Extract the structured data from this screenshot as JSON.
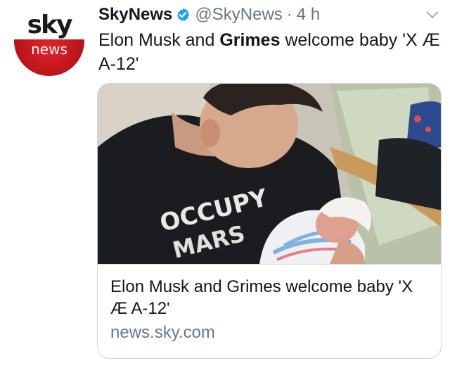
{
  "avatar": {
    "brand_top": "sky",
    "brand_bottom": "news"
  },
  "header": {
    "name": "SkyNews",
    "handle": "@SkyNews",
    "separator": "·",
    "time": "4 h"
  },
  "tweet": {
    "text_part1": "Elon Musk and ",
    "text_bold": "Grimes",
    "text_part2": " welcome baby 'X Æ A-12'"
  },
  "card": {
    "image_shirt_line1": "OCCUPY",
    "image_shirt_line2": "MARS",
    "title": "Elon Musk and Grimes welcome baby 'X Æ A-12'",
    "domain": "news.sky.com"
  },
  "colors": {
    "brand_red": "#c8161d",
    "verified_blue": "#1da1f2",
    "secondary_text": "#657786",
    "border": "#ccd6dd"
  },
  "icons": [
    "verified-badge-icon",
    "chevron-down-icon"
  ]
}
